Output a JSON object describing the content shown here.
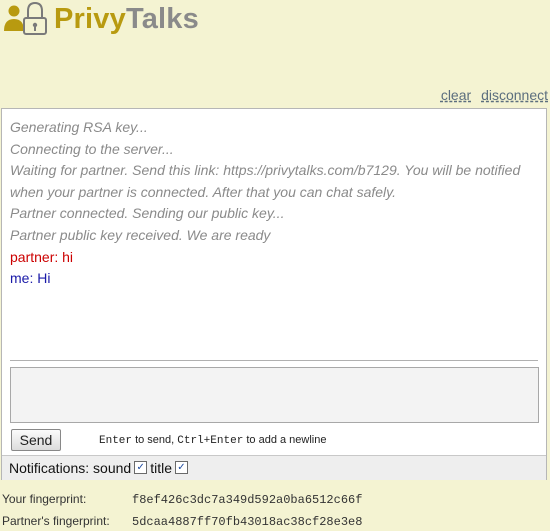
{
  "brand": {
    "part1": "Privy",
    "part2": "Talks"
  },
  "links": {
    "clear": "clear",
    "disconnect": "disconnect"
  },
  "log": {
    "sys1": "Generating RSA key...",
    "sys2": "Connecting to the server...",
    "sys3a": "Waiting for partner. Send this link: https://privytalks.com/b7129. You will be notified",
    "sys3b": "when your partner is connected. After that you can chat safely.",
    "sys4": "Partner connected. Sending our public key...",
    "sys5": "Partner public key received. We are ready",
    "partner_msg": "partner: hi",
    "me_msg": "me: Hi"
  },
  "composer": {
    "value": "",
    "send_label": "Send",
    "hint_key1": "Enter",
    "hint_mid": " to send, ",
    "hint_key2": "Ctrl+Enter",
    "hint_end": " to add a newline"
  },
  "notifications": {
    "label": "Notifications:",
    "sound": "sound",
    "title": "title",
    "sound_checked": true,
    "title_checked": true
  },
  "fingerprints": {
    "yours_label": "Your fingerprint:",
    "yours_value": "f8ef426c3dc7a349d592a0ba6512c66f",
    "partner_label": "Partner's fingerprint:",
    "partner_value": "5dcaa4887ff70fb43018ac38cf28e3e8"
  },
  "colors": {
    "background": "#f4f3d2",
    "brand_gold": "#b89a10",
    "brand_gray": "#8a8a8a",
    "partner": "#cc0000",
    "me": "#1a1aa8"
  },
  "icons": {
    "logo": "padlock-people-icon"
  }
}
